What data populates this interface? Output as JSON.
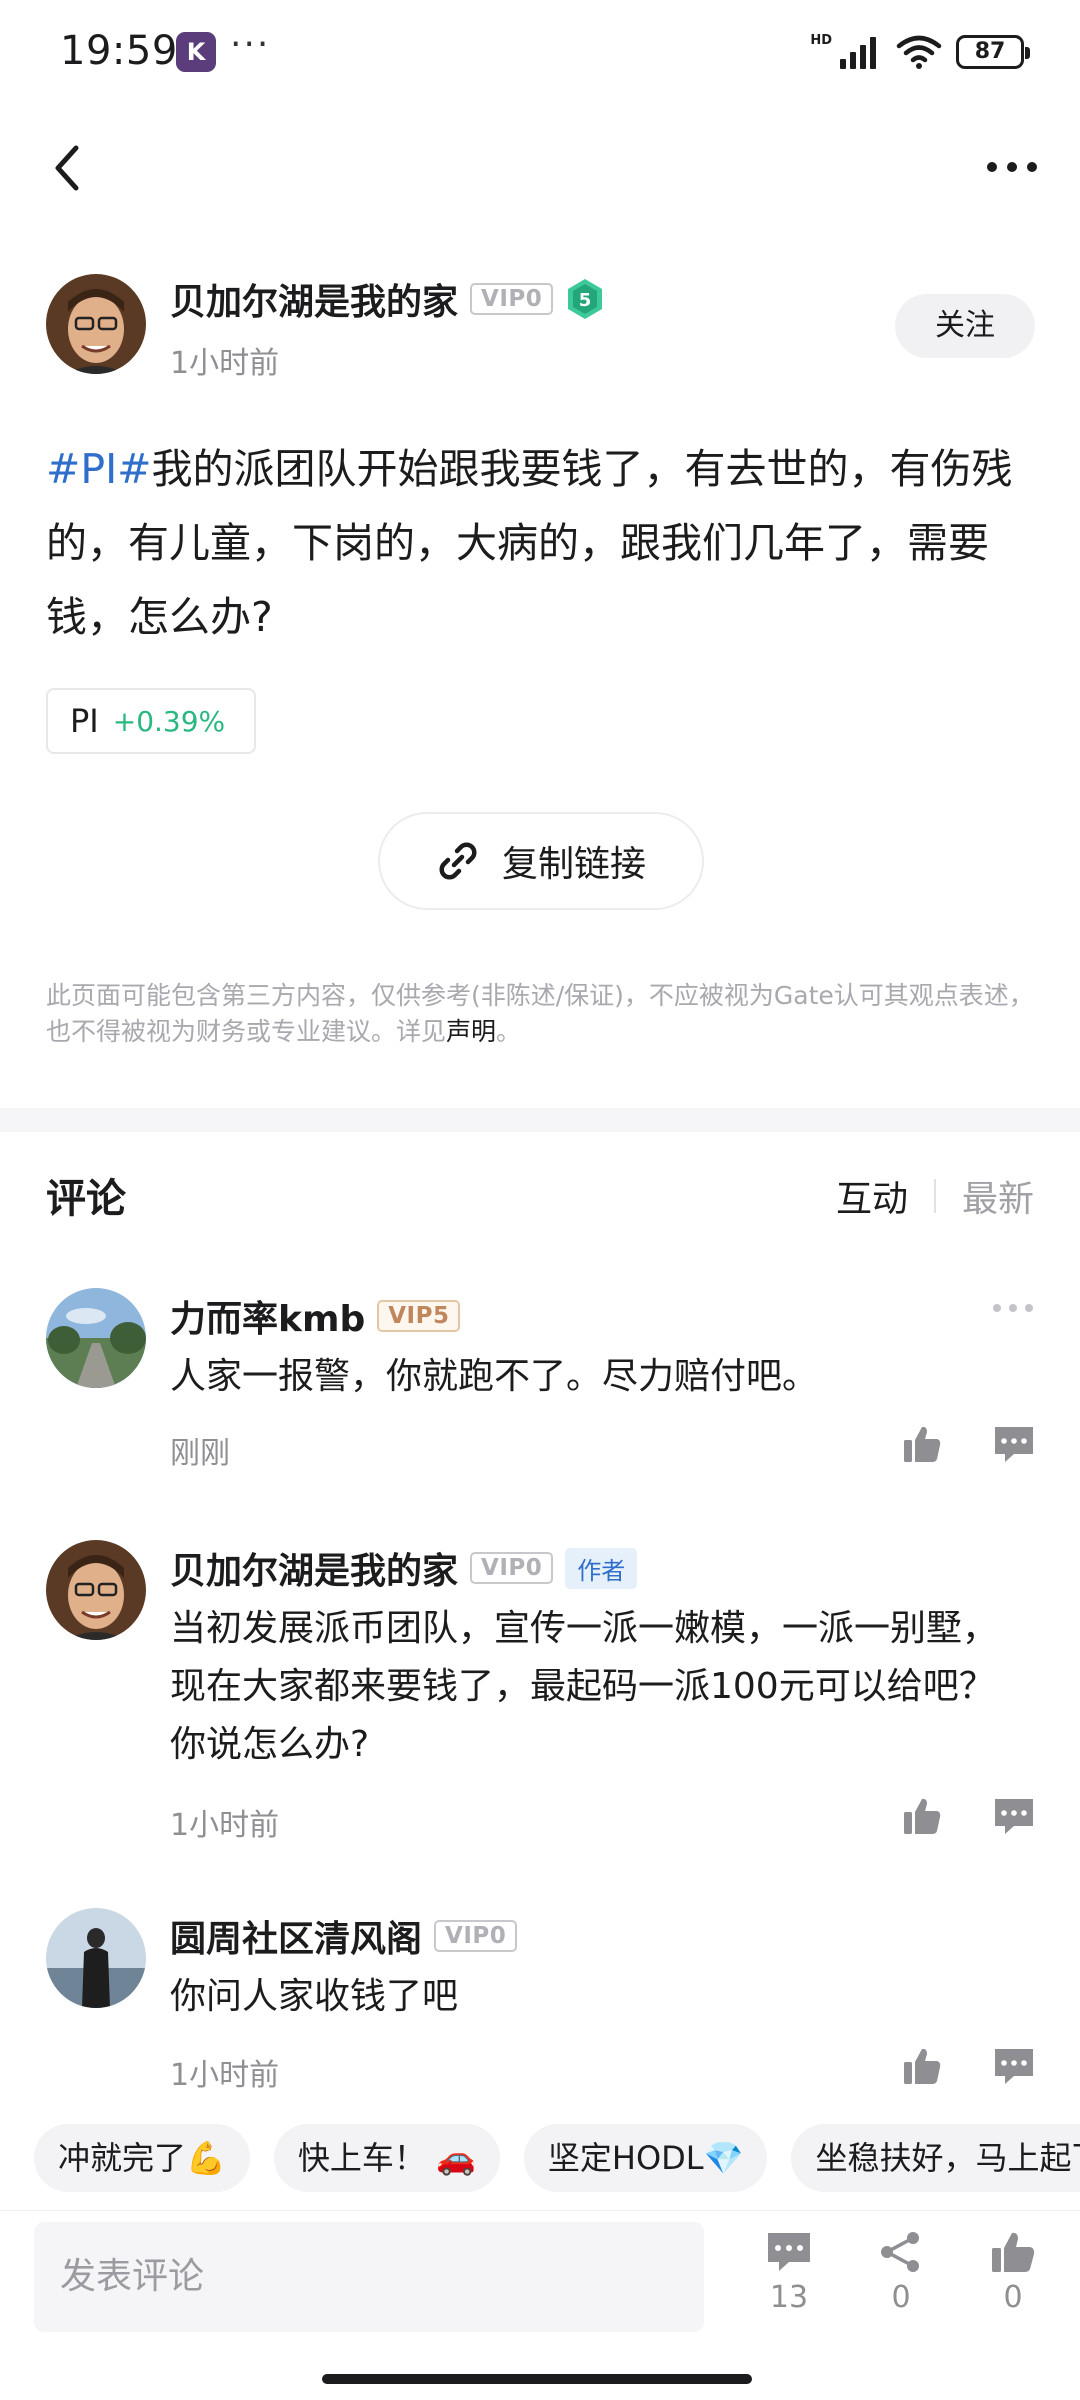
{
  "status_bar": {
    "time": "19:59",
    "app_icon": "K",
    "more": "···",
    "network": "HD",
    "battery": "87"
  },
  "nav": {
    "back_icon": "chevron-left-icon",
    "more_icon": "more-dots-icon"
  },
  "post": {
    "author": "贝加尔湖是我的家",
    "vip": "VIP0",
    "level": "5",
    "time": "1小时前",
    "follow_label": "关注",
    "hashtag": "#PI#",
    "content": "我的派团队开始跟我要钱了，有去世的，有伤残的，有儿童，下岗的，大病的，跟我们几年了，需要钱，怎么办?",
    "ticker": {
      "symbol": "PI",
      "change": "+0.39%"
    },
    "copy_link_label": "复制链接",
    "disclaimer": "此页面可能包含第三方内容，仅供参考(非陈述/保证)，不应被视为Gate认可其观点表述，也不得被视为财务或专业建议。详见",
    "disclaimer_link": "声明",
    "disclaimer_end": "。"
  },
  "comments_section": {
    "title": "评论",
    "sort_active": "互动",
    "sort_inactive": "最新",
    "items": [
      {
        "name": "力而率kmb",
        "vip": "VIP5",
        "text": "人家一报警，你就跑不了。尽力赔付吧。",
        "time": "刚刚"
      },
      {
        "name": "贝加尔湖是我的家",
        "vip": "VIP0",
        "tag": "作者",
        "text": "当初发展派币团队，宣传一派一嫩模，一派一别墅，现在大家都来要钱了，最起码一派100元可以给吧？你说怎么办?",
        "time": "1小时前"
      },
      {
        "name": "圆周社区清风阁",
        "vip": "VIP0",
        "text": "你问人家收钱了吧",
        "time": "1小时前"
      }
    ]
  },
  "quick_replies": [
    "冲就完了💪",
    "快上车！ 🚗",
    "坚定HODL💎",
    "坐稳扶好，马上起飞"
  ],
  "bottom_bar": {
    "input_placeholder": "发表评论",
    "comment_count": "13",
    "share_count": "0",
    "like_count": "0"
  },
  "colors": {
    "accent_blue": "#2f6fcb",
    "positive_green": "#29b880",
    "muted_gray": "#8e8e93"
  }
}
